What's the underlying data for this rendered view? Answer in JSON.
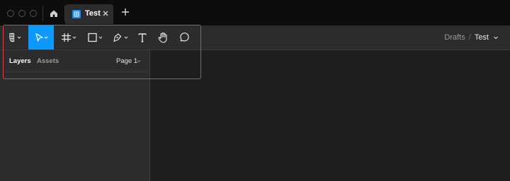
{
  "window": {
    "tab": {
      "label": "Test"
    },
    "icons": [
      "home-icon",
      "figma-file-icon",
      "close-icon",
      "plus-icon"
    ]
  },
  "toolbar": {
    "tools": [
      {
        "name": "main-menu",
        "icon": "figma-logo-icon",
        "has_dropdown": true
      },
      {
        "name": "move",
        "icon": "pointer-icon",
        "has_dropdown": true,
        "active": true
      },
      {
        "name": "frame",
        "icon": "hash-frame-icon",
        "has_dropdown": true
      },
      {
        "name": "shape",
        "icon": "rectangle-icon",
        "has_dropdown": true
      },
      {
        "name": "pen",
        "icon": "pen-icon",
        "has_dropdown": true
      },
      {
        "name": "text",
        "icon": "text-T-icon",
        "has_dropdown": false
      },
      {
        "name": "hand",
        "icon": "hand-icon",
        "has_dropdown": false
      },
      {
        "name": "comment",
        "icon": "speech-bubble-icon",
        "has_dropdown": false
      }
    ],
    "breadcrumb": {
      "folder": "Drafts",
      "separator": "/",
      "file": "Test"
    }
  },
  "sidebar": {
    "tabs": [
      {
        "label": "Layers",
        "active": true
      },
      {
        "label": "Assets",
        "active": false
      }
    ],
    "page": {
      "label": "Page 1"
    }
  },
  "colors": {
    "accent": "#0d99ff",
    "highlight_outline": "#d8434b",
    "toolbar_bg": "#2c2c2c",
    "canvas_bg": "#1e1e1e",
    "titlebar_bg": "#0d0d0d"
  }
}
